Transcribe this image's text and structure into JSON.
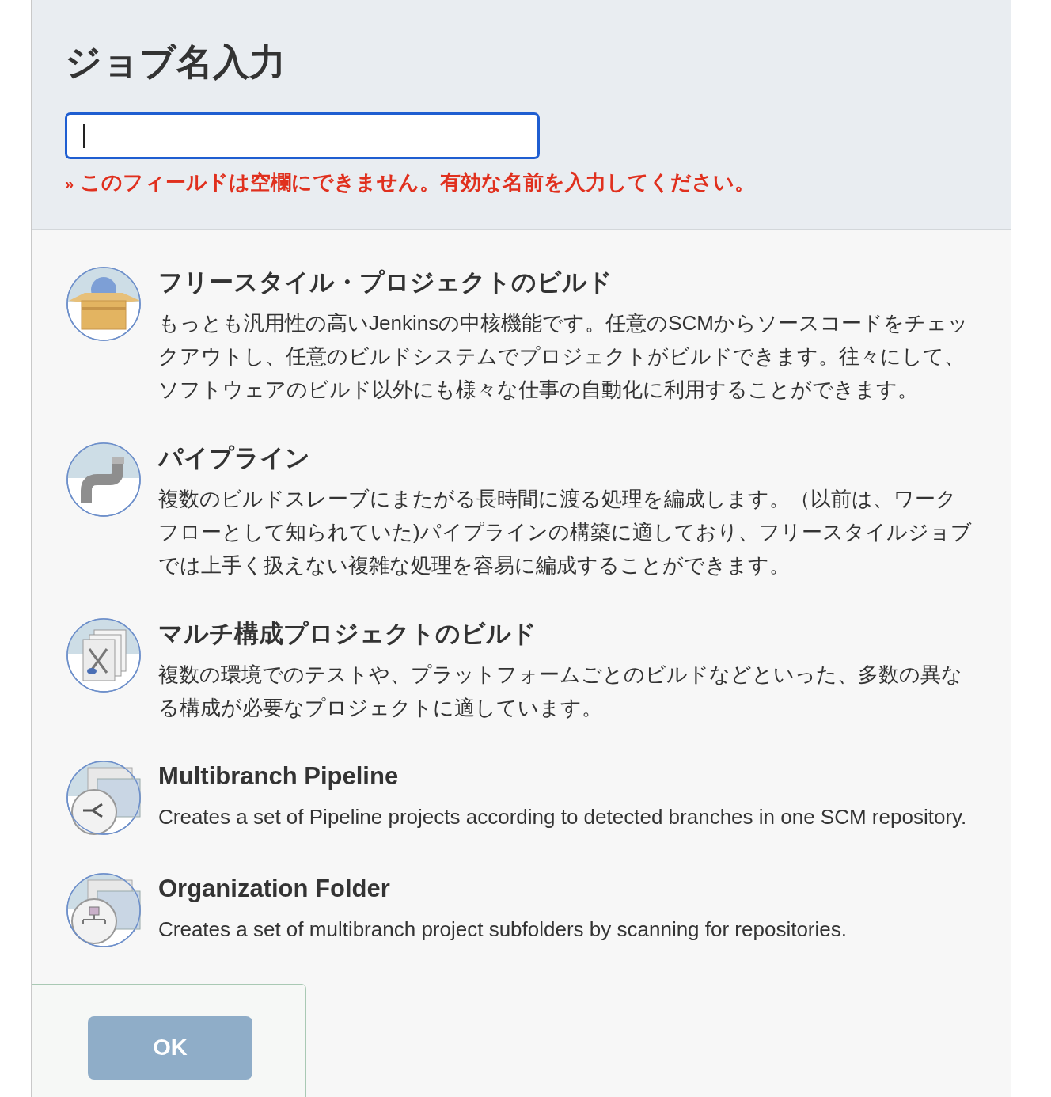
{
  "header": {
    "title": "ジョブ名入力",
    "name_field": {
      "focused": true
    },
    "error": {
      "marker": "»",
      "message": "このフィールドは空欄にできません。有効な名前を入力してください。"
    }
  },
  "job_types": [
    {
      "kind": "freestyle",
      "title": "フリースタイル・プロジェクトのビルド",
      "description": "もっとも汎用性の高いJenkinsの中核機能です。任意のSCMからソースコードをチェックアウトし、任意のビルドシステムでプロジェクトがビルドできます。往々にして、ソフトウェアのビルド以外にも様々な仕事の自動化に利用することができます。"
    },
    {
      "kind": "pipeline",
      "title": "パイプライン",
      "description": "複数のビルドスレーブにまたがる長時間に渡る処理を編成します。（以前は、ワークフローとして知られていた)パイプラインの構築に適しており、フリースタイルジョブでは上手く扱えない複雑な処理を容易に編成することができます。"
    },
    {
      "kind": "matrix",
      "title": "マルチ構成プロジェクトのビルド",
      "description": "複数の環境でのテストや、プラットフォームごとのビルドなどといった、多数の異なる構成が必要なプロジェクトに適しています。"
    },
    {
      "kind": "multibranch",
      "title": "Multibranch Pipeline",
      "description": "Creates a set of Pipeline projects according to detected branches in one SCM repository."
    },
    {
      "kind": "org-folder",
      "title": "Organization Folder",
      "description": "Creates a set of multibranch project subfolders by scanning for repositories."
    }
  ],
  "footer": {
    "button": "OK"
  }
}
